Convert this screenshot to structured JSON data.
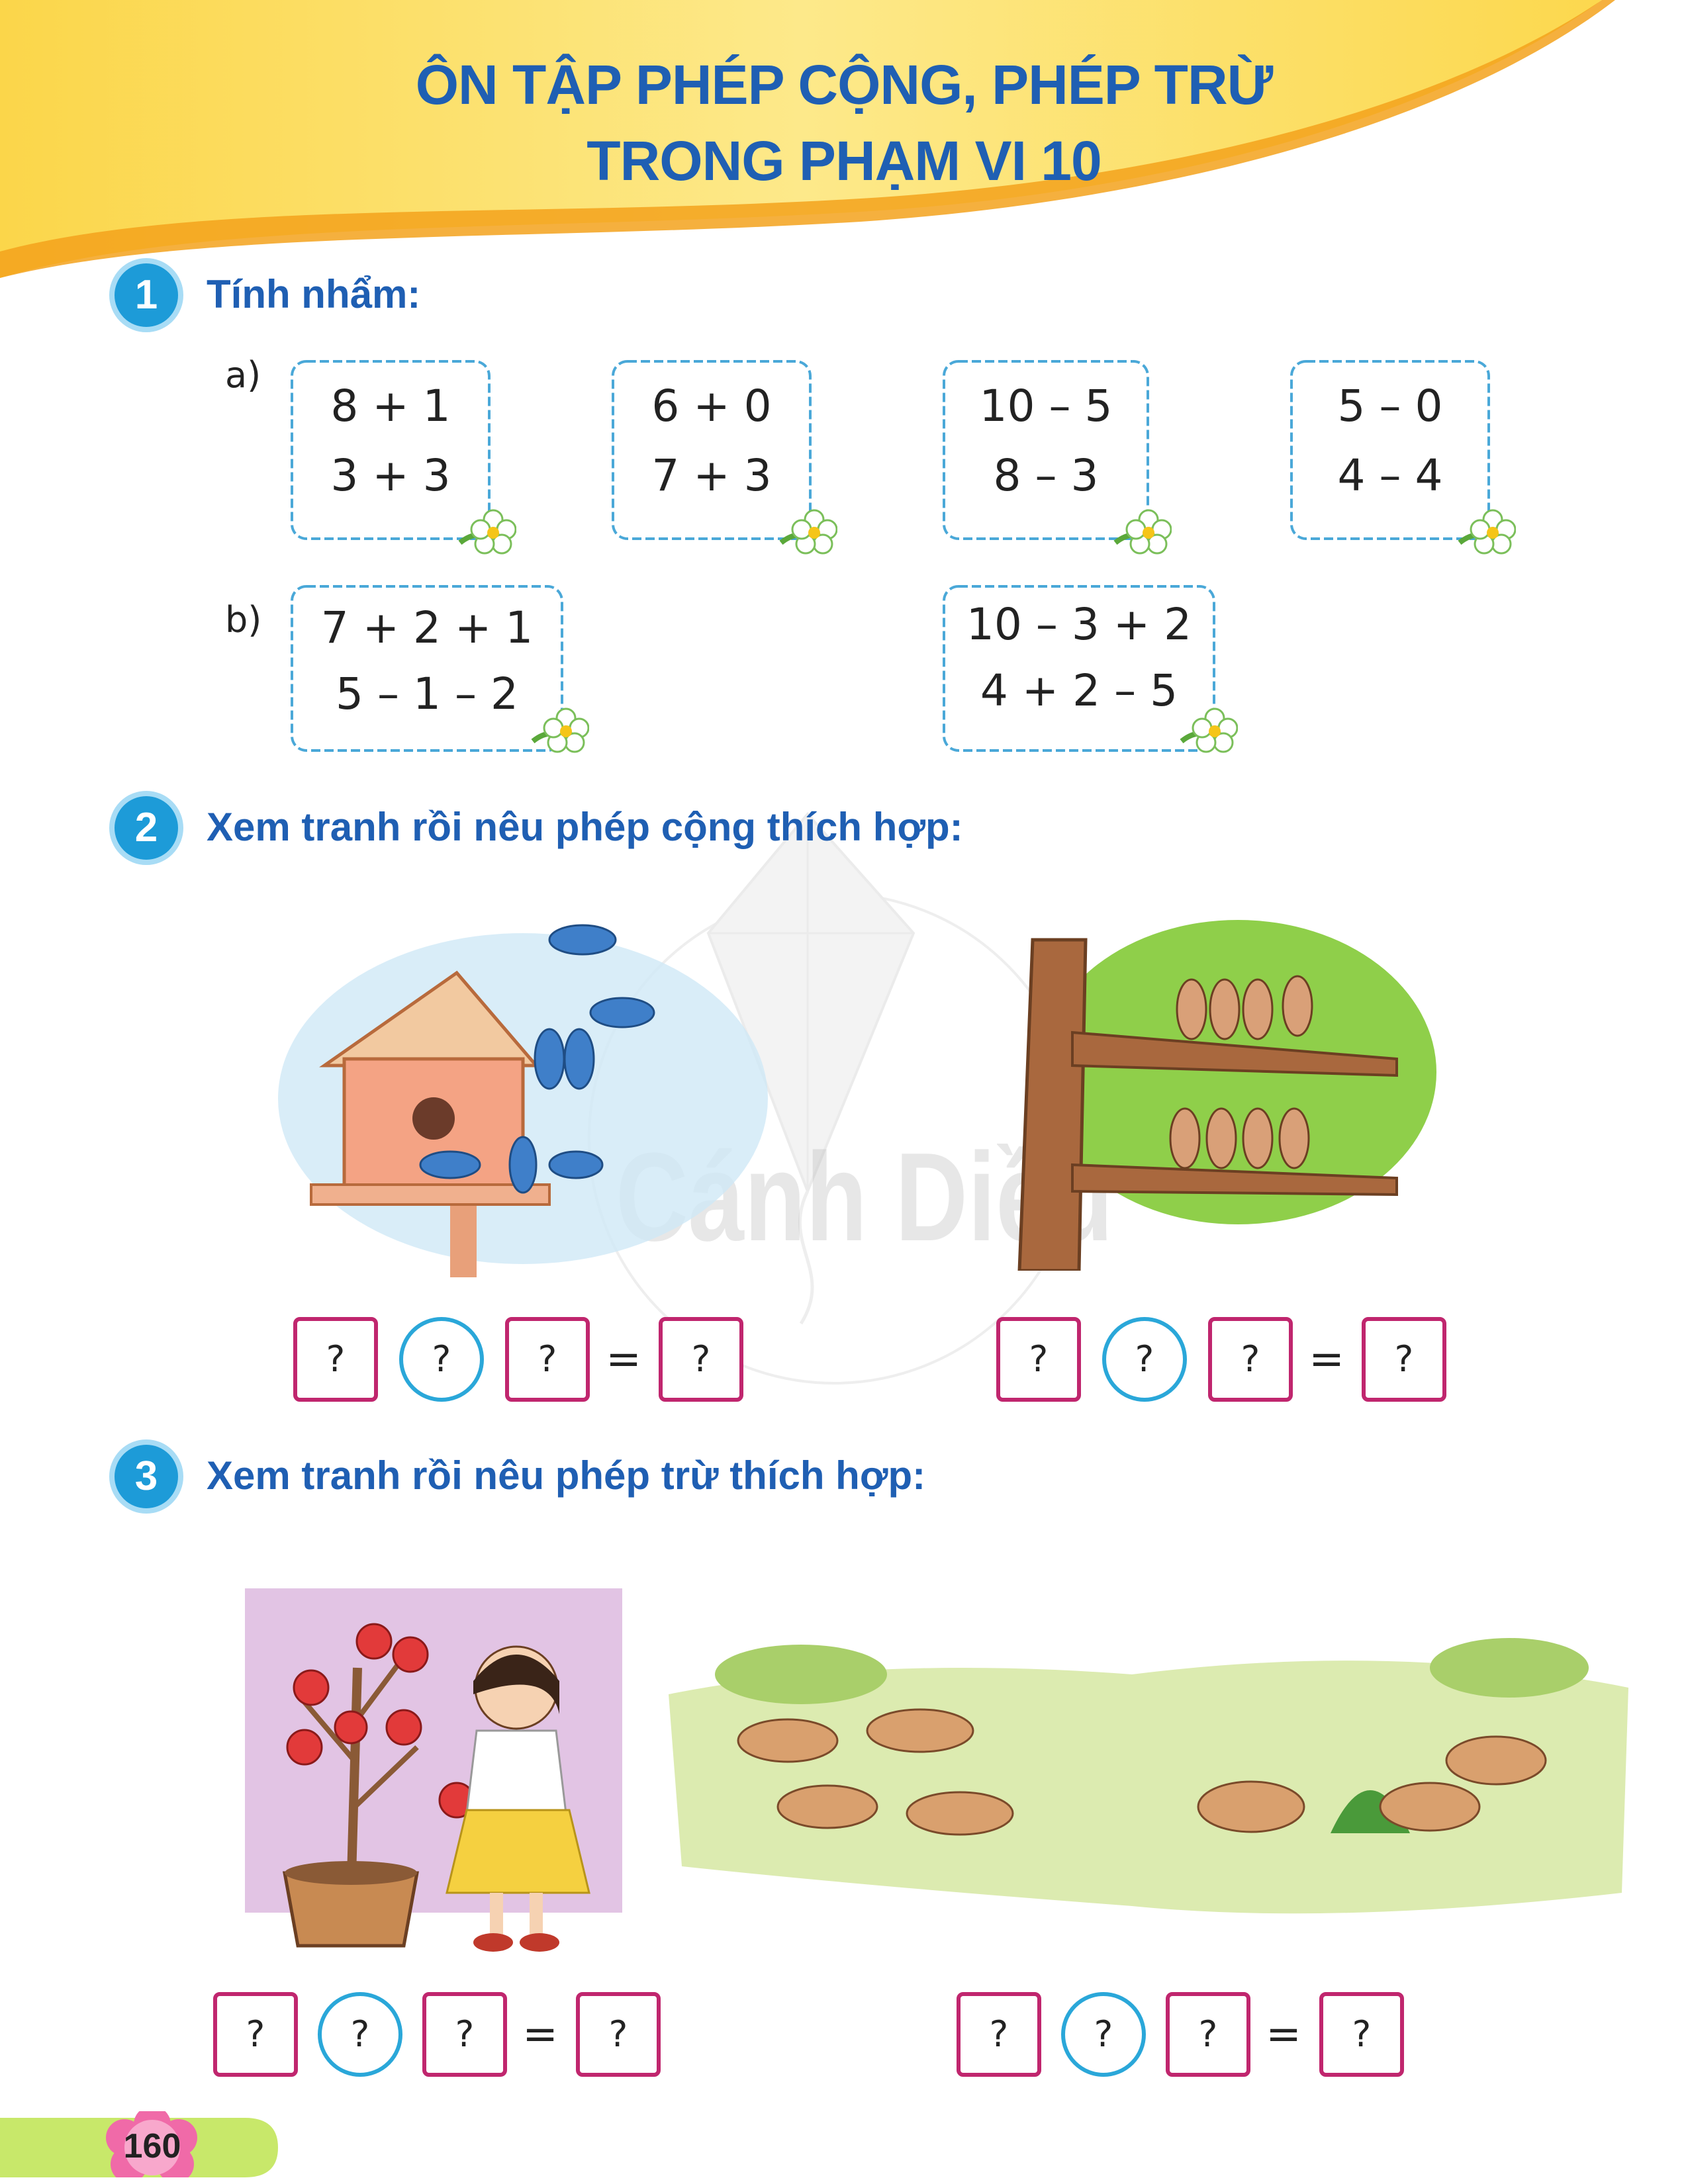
{
  "header": {
    "title_line1": "ÔN TẬP PHÉP CỘNG, PHÉP TRỪ",
    "title_line2": "TRONG PHẠM VI 10"
  },
  "watermark": {
    "text": "Cánh Diều"
  },
  "section1": {
    "number": "1",
    "title": "Tính nhẩm:",
    "part_a": {
      "label": "a)",
      "boxes": [
        {
          "line1": "8 + 1",
          "line2": "3 + 3"
        },
        {
          "line1": "6 + 0",
          "line2": "7 + 3"
        },
        {
          "line1": "10 – 5",
          "line2": "8 – 3"
        },
        {
          "line1": "5 – 0",
          "line2": "4 – 4"
        }
      ]
    },
    "part_b": {
      "label": "b)",
      "boxes": [
        {
          "line1": "7 + 2 + 1",
          "line2": "5 – 1 – 2"
        },
        {
          "line1": "10 – 3 + 2",
          "line2": "4 + 2 – 5"
        }
      ]
    }
  },
  "section2": {
    "number": "2",
    "title": "Xem tranh rồi nêu phép cộng thích hợp:",
    "equations": [
      {
        "slots": [
          "?",
          "?",
          "?"
        ],
        "equals": "=",
        "result": "?"
      },
      {
        "slots": [
          "?",
          "?",
          "?"
        ],
        "equals": "=",
        "result": "?"
      }
    ]
  },
  "section3": {
    "number": "3",
    "title": "Xem tranh rồi nêu phép trừ thích hợp:",
    "equations": [
      {
        "slots": [
          "?",
          "?",
          "?"
        ],
        "equals": "=",
        "result": "?"
      },
      {
        "slots": [
          "?",
          "?",
          "?"
        ],
        "equals": "=",
        "result": "?"
      }
    ]
  },
  "footer": {
    "page_number": "160"
  },
  "colors": {
    "title_blue": "#1f5fb3",
    "badge_blue": "#1d9bd8",
    "answer_box_border": "#c0266e",
    "answer_circle_border": "#2aa7d9",
    "header_yellow": "#fbd84a",
    "page_tab_green": "#c8e86a",
    "page_flower_pink": "#f06aa8"
  }
}
